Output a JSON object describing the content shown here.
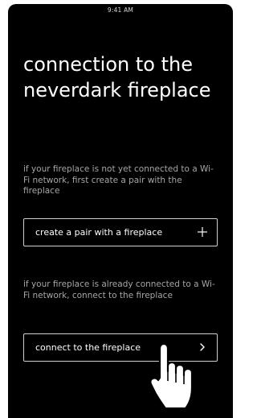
{
  "status_bar": {
    "time": "9:41 AM"
  },
  "title": "connection to the neverdark fireplace",
  "section_new": {
    "description": "if your fireplace is not yet connected to a Wi-Fi network, first create a pair with the fireplace",
    "button_label": "create a pair with a fireplace",
    "button_icon": "plus-icon"
  },
  "section_existing": {
    "description": "if your fireplace is already connected to a Wi-Fi network, connect to the fireplace",
    "button_label": "connect to the fireplace",
    "button_icon": "chevron-right-icon"
  },
  "pointer_icon": "hand-pointer-icon",
  "colors": {
    "screen_background": "#000000",
    "primary_text": "#ffffff",
    "secondary_text": "#a6a6a6",
    "button_border": "#d0d0d0"
  }
}
